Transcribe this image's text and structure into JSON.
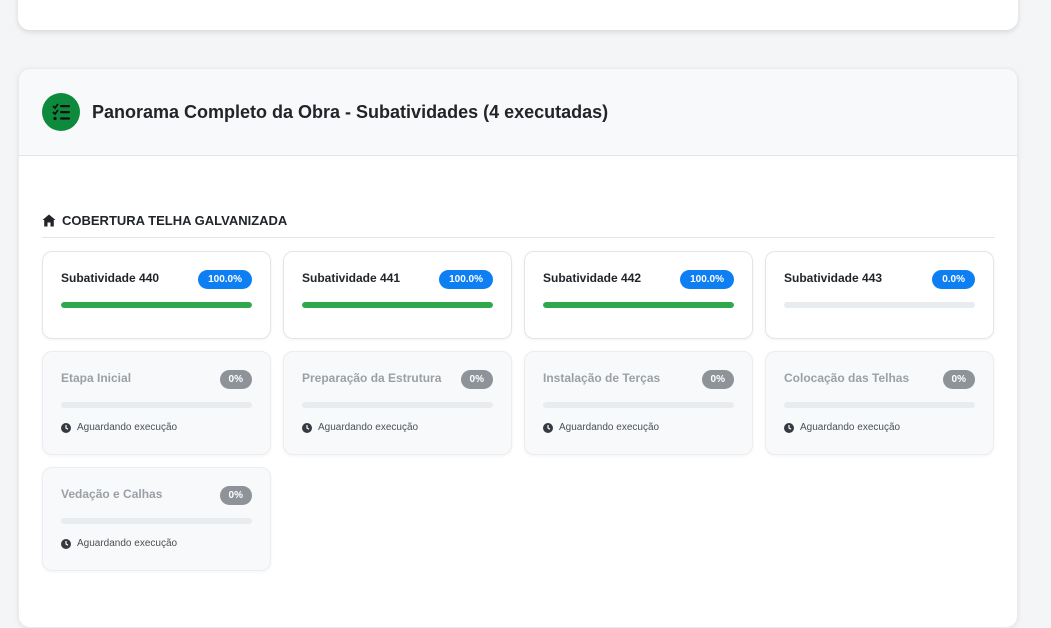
{
  "panel": {
    "title": "Panorama Completo da Obra - Subatividades (4 executadas)",
    "icon": "tasks-list-icon",
    "icon_color": "#0d8a3c"
  },
  "section": {
    "title": "COBERTURA TELHA GALVANIZADA",
    "icon": "home-icon"
  },
  "executed": [
    {
      "name": "Subatividade 440",
      "percent_label": "100.0%",
      "progress": 1.0
    },
    {
      "name": "Subatividade 441",
      "percent_label": "100.0%",
      "progress": 1.0
    },
    {
      "name": "Subatividade 442",
      "percent_label": "100.0%",
      "progress": 1.0
    },
    {
      "name": "Subatividade 443",
      "percent_label": "0.0%",
      "progress": 0.0
    }
  ],
  "pending": [
    {
      "name": "Etapa Inicial",
      "percent_label": "0%",
      "status": "Aguardando execução"
    },
    {
      "name": "Preparação da Estrutura",
      "percent_label": "0%",
      "status": "Aguardando execução"
    },
    {
      "name": "Instalação de Terças",
      "percent_label": "0%",
      "status": "Aguardando execução"
    },
    {
      "name": "Colocação das Telhas",
      "percent_label": "0%",
      "status": "Aguardando execução"
    },
    {
      "name": "Vedação e Calhas",
      "percent_label": "0%",
      "status": "Aguardando execução"
    }
  ],
  "colors": {
    "badge_blue": "#0d7ff2",
    "badge_gray": "#8e9399",
    "progress_green": "#2ea84a"
  }
}
